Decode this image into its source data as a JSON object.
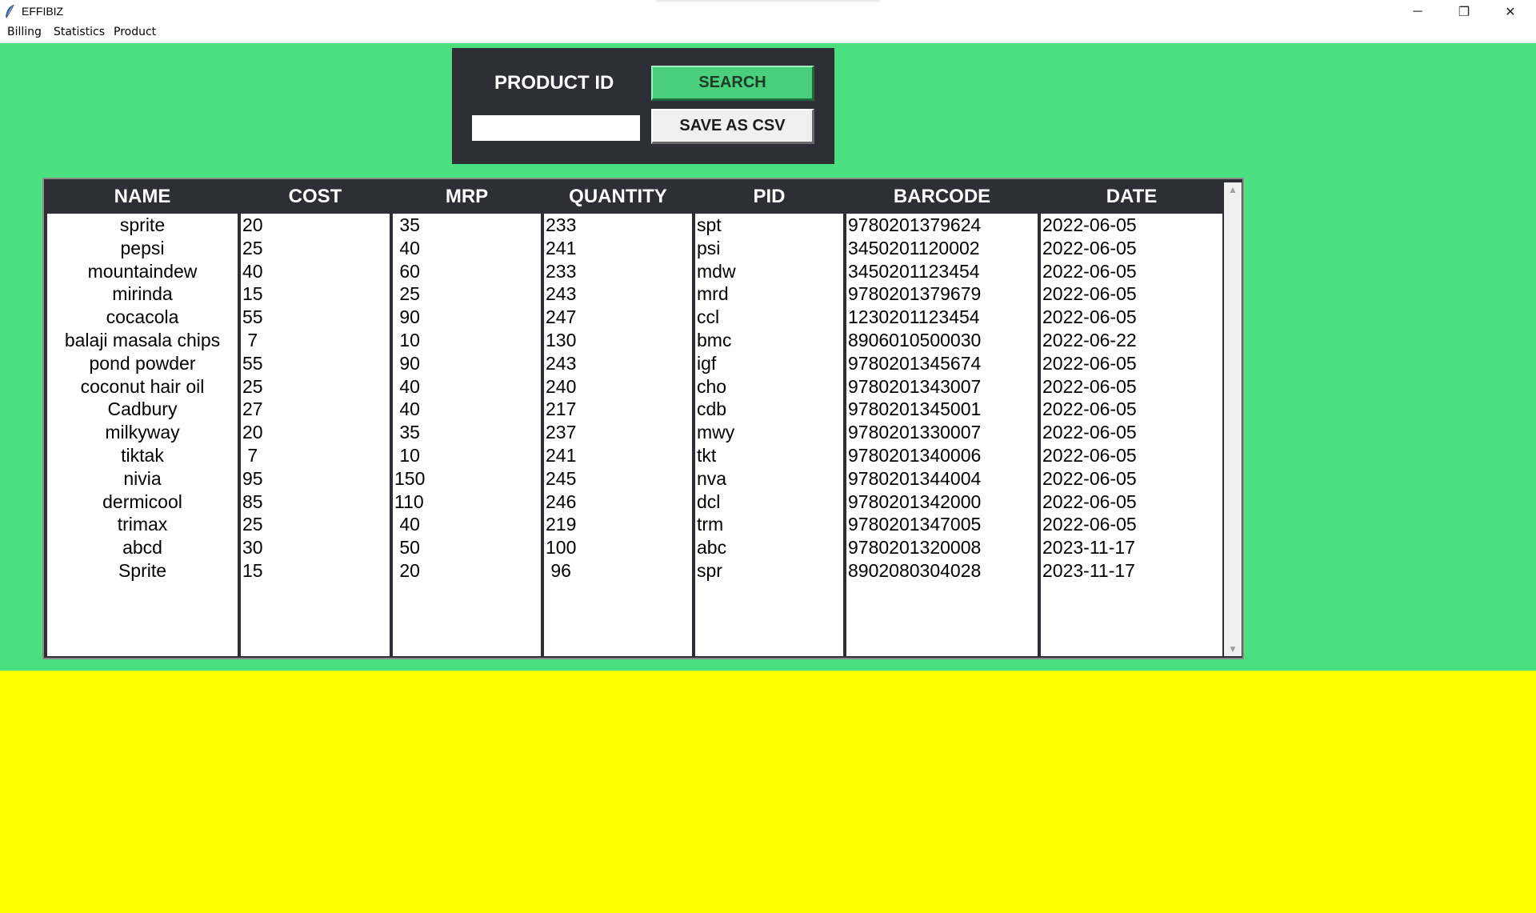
{
  "window": {
    "title": "EFFIBIZ",
    "controls": {
      "minimize": "─",
      "maximize": "❐",
      "close": "✕"
    }
  },
  "menu": [
    "Billing",
    "Statistics",
    "Product"
  ],
  "search_panel": {
    "label": "PRODUCT ID",
    "input_value": "",
    "search_button": "SEARCH",
    "csv_button": "SAVE AS CSV"
  },
  "colors": {
    "green_bg": "#4ae080",
    "yellow_bg": "#ffff00",
    "panel_bg": "#2e2e36"
  },
  "table": {
    "columns": [
      "NAME",
      "COST",
      "MRP",
      "QUANTITY",
      "PID",
      "BARCODE",
      "DATE"
    ],
    "rows": [
      [
        "sprite",
        "20",
        " 35",
        "233",
        "spt",
        "9780201379624",
        "2022-06-05"
      ],
      [
        "pepsi",
        "25",
        " 40",
        "241",
        "psi",
        "3450201120002",
        "2022-06-05"
      ],
      [
        "mountaindew",
        "40",
        " 60",
        "233",
        "mdw",
        "3450201123454",
        "2022-06-05"
      ],
      [
        "mirinda",
        "15",
        " 25",
        "243",
        "mrd",
        "9780201379679",
        "2022-06-05"
      ],
      [
        "cocacola",
        "55",
        " 90",
        "247",
        "ccl",
        "1230201123454",
        "2022-06-05"
      ],
      [
        "balaji masala chips",
        " 7",
        " 10",
        "130",
        "bmc",
        "8906010500030",
        "2022-06-22"
      ],
      [
        "pond powder",
        "55",
        " 90",
        "243",
        "igf",
        "9780201345674",
        "2022-06-05"
      ],
      [
        "coconut hair oil",
        "25",
        " 40",
        "240",
        "cho",
        "9780201343007",
        "2022-06-05"
      ],
      [
        "Cadbury",
        "27",
        " 40",
        "217",
        "cdb",
        "9780201345001",
        "2022-06-05"
      ],
      [
        "milkyway",
        "20",
        " 35",
        "237",
        "mwy",
        "9780201330007",
        "2022-06-05"
      ],
      [
        "tiktak",
        " 7",
        " 10",
        "241",
        "tkt",
        "9780201340006",
        "2022-06-05"
      ],
      [
        "nivia",
        "95",
        "150",
        "245",
        "nva",
        "9780201344004",
        "2022-06-05"
      ],
      [
        "dermicool",
        "85",
        "110",
        "246",
        "dcl",
        "9780201342000",
        "2022-06-05"
      ],
      [
        "trimax",
        "25",
        " 40",
        "219",
        "trm",
        "9780201347005",
        "2022-06-05"
      ],
      [
        "abcd",
        "30",
        " 50",
        "100",
        "abc",
        "9780201320008",
        "2023-11-17"
      ],
      [
        "Sprite",
        "15",
        " 20",
        " 96",
        "spr",
        "8902080304028",
        "2023-11-17"
      ]
    ]
  },
  "scrollbar": {
    "up": "▲",
    "down": "▼"
  }
}
